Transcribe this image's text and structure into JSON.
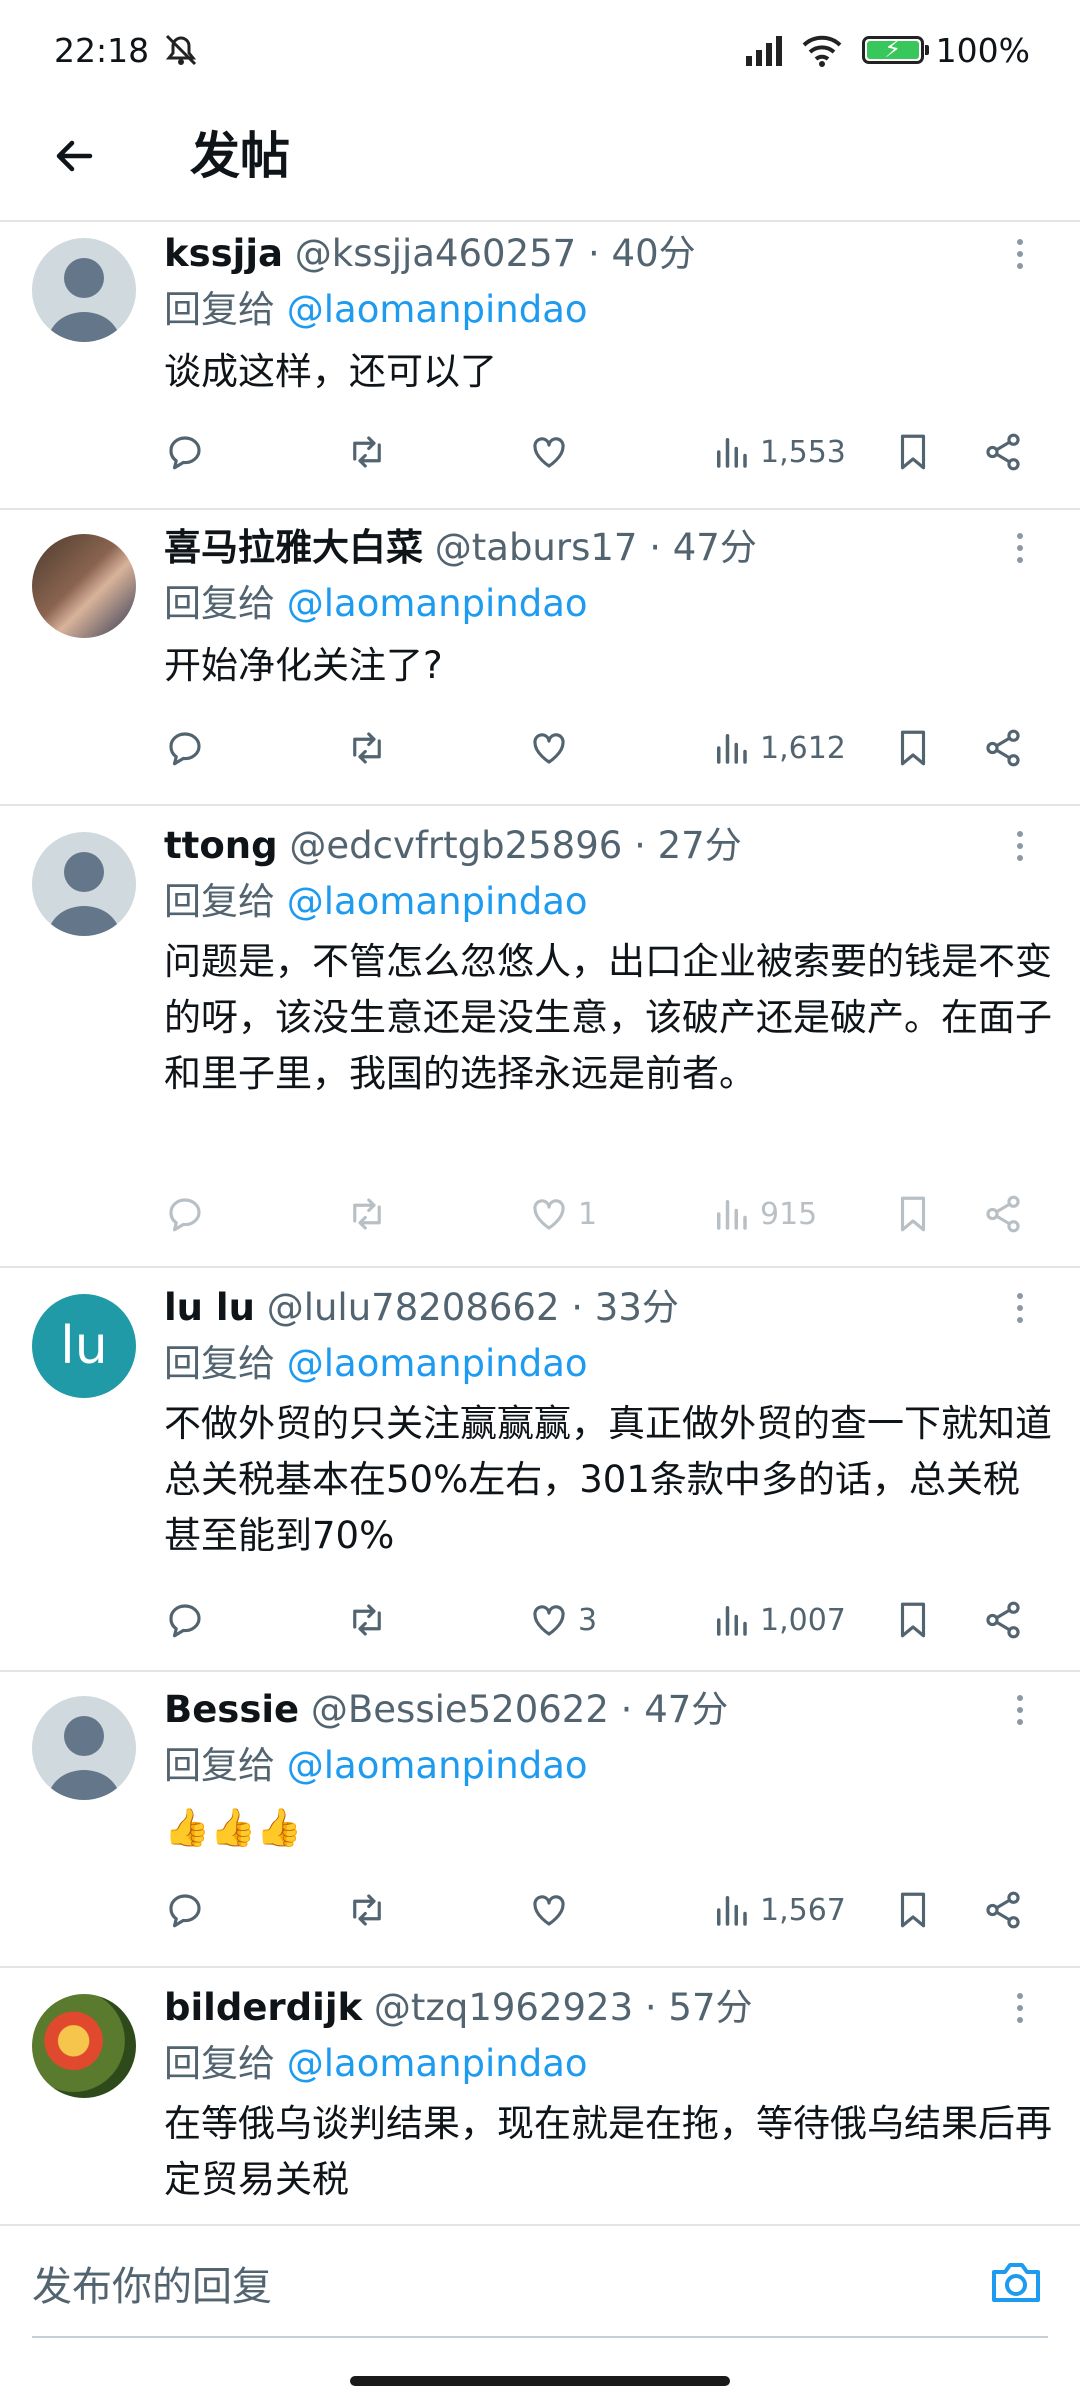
{
  "status_bar": {
    "time": "22:18",
    "battery": "100%"
  },
  "app_bar": {
    "title": "发帖"
  },
  "replies": [
    {
      "name": "kssjja",
      "handle": "@kssjja460257",
      "time": "40分",
      "reply_prefix": "回复给",
      "reply_handle": "@laomanpindao",
      "text": "谈成这样，还可以了",
      "likes": "",
      "views": "1,553"
    },
    {
      "name": "喜马拉雅大白菜",
      "handle": "@taburs17",
      "time": "47分",
      "reply_prefix": "回复给",
      "reply_handle": "@laomanpindao",
      "text": "开始净化关注了?",
      "likes": "",
      "views": "1,612"
    },
    {
      "name": "ttong",
      "handle": "@edcvfrtgb25896",
      "time": "27分",
      "reply_prefix": "回复给",
      "reply_handle": "@laomanpindao",
      "text": "问题是，不管怎么忽悠人，出口企业被索要的钱是不变的呀，该没生意还是没生意，该破产还是破产。在面子和里子里，我国的选择永远是前者。",
      "likes": "1",
      "views": "915"
    },
    {
      "name": "lu lu",
      "handle": "@lulu78208662",
      "time": "33分",
      "avatar_text": "lu",
      "reply_prefix": "回复给",
      "reply_handle": "@laomanpindao",
      "text": "不做外贸的只关注赢赢赢，真正做外贸的查一下就知道总关税基本在50%左右，301条款中多的话，总关税甚至能到70%",
      "likes": "3",
      "views": "1,007"
    },
    {
      "name": "Bessie",
      "handle": "@Bessie520622",
      "time": "47分",
      "reply_prefix": "回复给",
      "reply_handle": "@laomanpindao",
      "text": "👍👍👍",
      "likes": "",
      "views": "1,567"
    },
    {
      "name": "bilderdijk",
      "handle": "@tzq1962923",
      "time": "57分",
      "reply_prefix": "回复给",
      "reply_handle": "@laomanpindao",
      "text": "在等俄乌谈判结果，现在就是在拖，等待俄乌结果后再定贸易关税",
      "likes": "",
      "views": ""
    }
  ],
  "composer": {
    "placeholder": "发布你的回复"
  },
  "colors": {
    "link": "#1d9bf0",
    "secondary": "#536471",
    "divider": "#e1e5e8"
  }
}
